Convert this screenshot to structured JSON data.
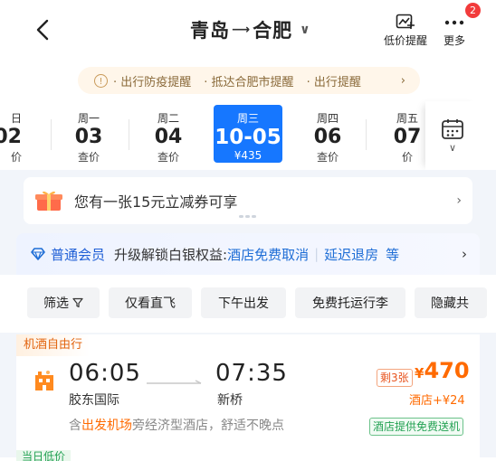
{
  "header": {
    "origin": "青岛",
    "destination": "合肥",
    "low_price_alert_label": "低价提醒",
    "more_label": "更多",
    "more_badge": "2"
  },
  "notice": {
    "items": [
      "出行防疫提醒",
      "抵达合肥市提醒",
      "出行提醒"
    ]
  },
  "dates": [
    {
      "weekday": "日",
      "day": "02",
      "price": "价"
    },
    {
      "weekday": "周一",
      "day": "03",
      "price": "查价"
    },
    {
      "weekday": "周二",
      "day": "04",
      "price": "查价"
    },
    {
      "weekday": "周三",
      "day": "10-05",
      "price": "¥435",
      "selected": true
    },
    {
      "weekday": "周四",
      "day": "06",
      "price": "查价"
    },
    {
      "weekday": "周五",
      "day": "07",
      "price": "价"
    }
  ],
  "coupon": {
    "text": "您有一张15元立减券可享"
  },
  "member": {
    "level": "普通会员",
    "upgrade_text": "升级解锁白银权益:",
    "benefit1": "酒店免费取消",
    "benefit2": "延迟退房",
    "benefit_more": "等"
  },
  "filters": [
    "筛选",
    "仅看直飞",
    "下午出发",
    "免费托运行李",
    "隐藏共"
  ],
  "flight": {
    "tag": "机酒自由行",
    "depart_time": "06:05",
    "arrive_time": "07:35",
    "depart_airport": "胶东国际",
    "arrive_airport": "新桥",
    "seats_left": "剩3张",
    "price_currency": "¥",
    "price": "470",
    "hotel_plus": "酒店+¥24",
    "desc_prefix": "含",
    "desc_highlight": "出发机场",
    "desc_suffix": "旁经济型酒店，舒适不晚点",
    "shuttle": "酒店提供免费送机"
  },
  "next_tag": "当日低价",
  "colors": {
    "accent": "#1677ff",
    "price": "#ff6a00",
    "green": "#22a152"
  }
}
